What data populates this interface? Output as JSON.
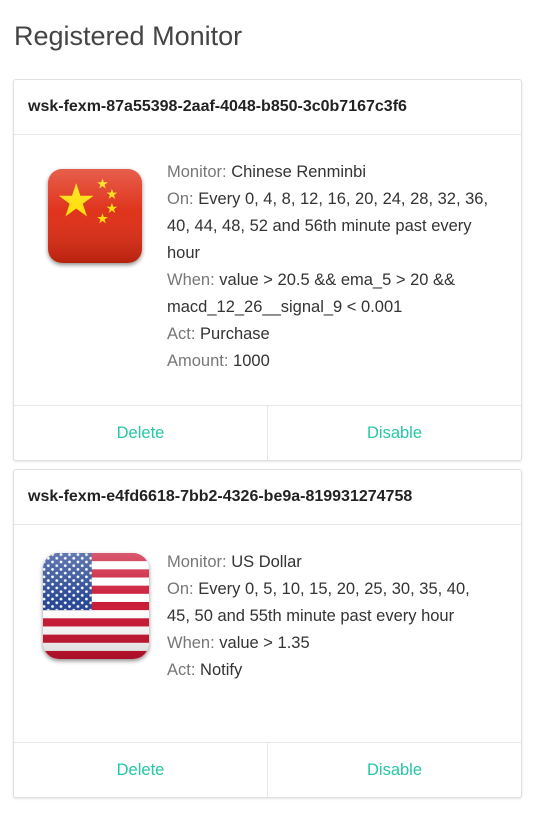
{
  "page": {
    "title": "Registered Monitor"
  },
  "colors": {
    "accent": "#26c6a6",
    "label": "#777777",
    "text": "#333333"
  },
  "monitors": [
    {
      "id": "wsk-fexm-87a55398-2aaf-4048-b850-3c0b7167c3f6",
      "flag_icon": "china-flag-icon",
      "monitor_label": "Monitor:",
      "monitor": "Chinese Renminbi",
      "on_label": "On:",
      "on": "Every 0, 4, 8, 12, 16, 20, 24, 28, 32, 36, 40, 44, 48, 52 and 56th minute past every hour",
      "when_label": "When:",
      "when": "value > 20.5 && ema_5 > 20 && macd_12_26__signal_9 < 0.001",
      "act_label": "Act:",
      "act": "Purchase",
      "amount_label": "Amount:",
      "amount": "1000",
      "delete_label": "Delete",
      "disable_label": "Disable"
    },
    {
      "id": "wsk-fexm-e4fd6618-7bb2-4326-be9a-819931274758",
      "flag_icon": "usa-flag-icon",
      "monitor_label": "Monitor:",
      "monitor": "US Dollar",
      "on_label": "On:",
      "on": "Every 0, 5, 10, 15, 20, 25, 30, 35, 40, 45, 50 and 55th minute past every hour",
      "when_label": "When:",
      "when": "value > 1.35",
      "act_label": "Act:",
      "act": "Notify",
      "delete_label": "Delete",
      "disable_label": "Disable"
    }
  ]
}
